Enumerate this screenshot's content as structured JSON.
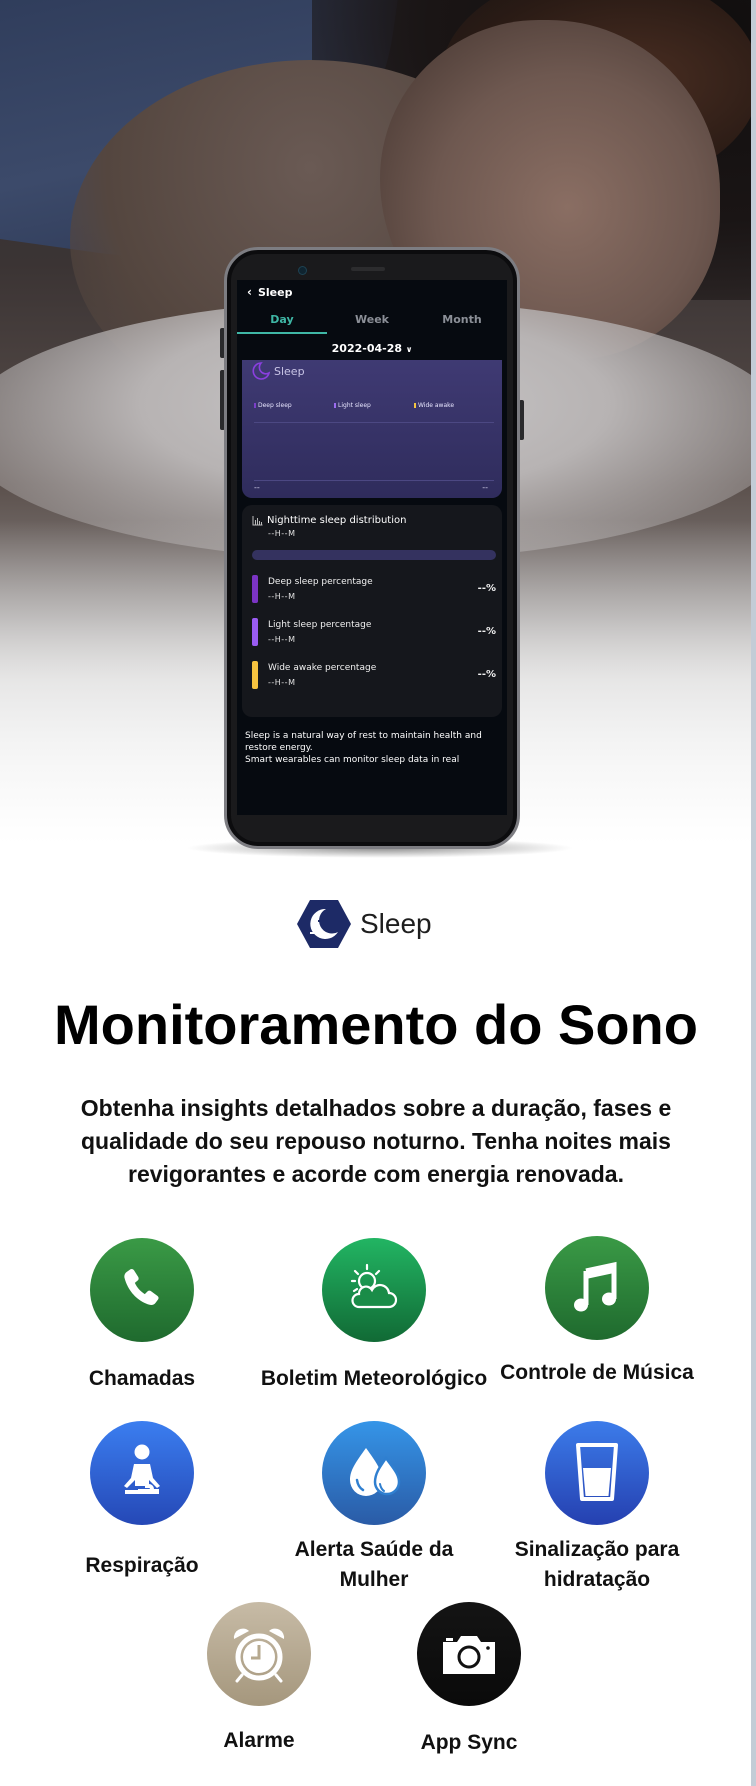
{
  "phone": {
    "header": {
      "back_icon": "chevron-left-icon",
      "title": "Sleep"
    },
    "tabs": [
      {
        "label": "Day",
        "active": true
      },
      {
        "label": "Week",
        "active": false
      },
      {
        "label": "Month",
        "active": false
      }
    ],
    "date_selector": {
      "value": "2022-04-28",
      "icon": "chevron-down-icon"
    },
    "sleep_chart": {
      "title": "Sleep",
      "icon": "moon-icon",
      "legend": [
        {
          "label": "Deep sleep",
          "color": "#7b3fc9"
        },
        {
          "label": "Light sleep",
          "color": "#9b6cf0"
        },
        {
          "label": "Wide awake",
          "color": "#f5c542"
        }
      ],
      "start_label": "--",
      "end_label": "--"
    },
    "distribution": {
      "icon": "bar-chart-icon",
      "title": "Nighttime sleep distribution",
      "total": "--H--M",
      "rows": [
        {
          "label": "Deep sleep percentage",
          "duration": "--H--M",
          "percent": "--%",
          "color": "#7b34c4"
        },
        {
          "label": "Light sleep percentage",
          "duration": "--H--M",
          "percent": "--%",
          "color": "#9a5cf2"
        },
        {
          "label": "Wide awake percentage",
          "duration": "--H--M",
          "percent": "--%",
          "color": "#f6c340"
        }
      ]
    },
    "description": "Sleep is a natural way of rest to maintain health and restore energy.\n Smart wearables can monitor sleep data in real"
  },
  "brand": {
    "icon": "sleep-logo-icon",
    "name": "Sleep",
    "color": "#1d2a66"
  },
  "headline": "Monitoramento do Sono",
  "subheadline": "Obtenha insights detalhados sobre a duração, fases e qualidade do seu repouso noturno. Tenha noites mais revigorantes e acorde com energia renovada.",
  "features": [
    {
      "label": "Chamadas",
      "icon": "phone-icon",
      "color_top": "#3a9a46",
      "color_bottom": "#1f6a2e"
    },
    {
      "label": "Boletim Meteorológico",
      "icon": "weather-icon",
      "color_top": "#22b563",
      "color_bottom": "#116a35"
    },
    {
      "label": "Controle de Música",
      "icon": "music-note-icon",
      "color_top": "#3a9a46",
      "color_bottom": "#1f6a2e"
    },
    {
      "label": "Respiração",
      "icon": "meditation-icon",
      "color_top": "#3b7ef0",
      "color_bottom": "#2548b6"
    },
    {
      "label": "Alerta Saúde da Mulher",
      "icon": "water-drops-icon",
      "color_top": "#3595e8",
      "color_bottom": "#2a5ba6"
    },
    {
      "label": "Sinalização para hidratação",
      "icon": "water-glass-icon",
      "color_top": "#3c7cea",
      "color_bottom": "#2540b0"
    },
    {
      "label": "Alarme",
      "icon": "alarm-clock-icon",
      "color_top": "#c7bba6",
      "color_bottom": "#a5977d"
    },
    {
      "label": "App Sync",
      "icon": "camera-icon",
      "color_top": "#141414",
      "color_bottom": "#0a0a0a"
    }
  ]
}
